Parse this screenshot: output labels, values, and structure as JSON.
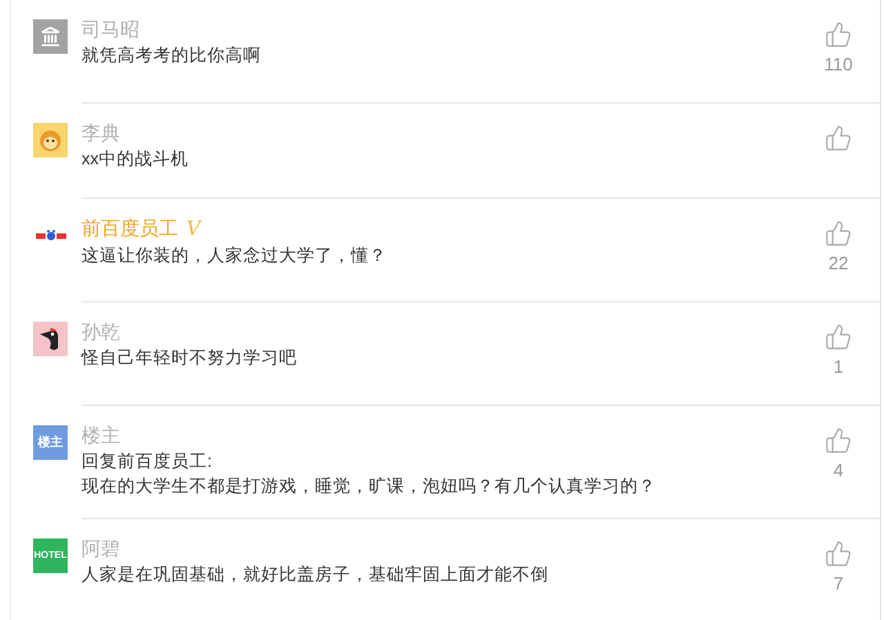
{
  "comments": [
    {
      "avatar": {
        "kind": "building",
        "color": "#a3a3a3"
      },
      "name": "司马昭",
      "vip": false,
      "lines": [
        "就凭高考考的比你高啊"
      ],
      "likes": "110"
    },
    {
      "avatar": {
        "kind": "face",
        "color": "#f7d56b"
      },
      "name": "李典",
      "vip": false,
      "lines": [
        "xx中的战斗机"
      ]
    },
    {
      "avatar": {
        "kind": "paw",
        "color": "#ffffff"
      },
      "name": "前百度员工",
      "vip": true,
      "vip_mark": "V",
      "lines": [
        "这逼让你装的，人家念过大学了，懂？"
      ],
      "likes": "22"
    },
    {
      "avatar": {
        "kind": "bird",
        "color": "#f3c3c8"
      },
      "name": "孙乾",
      "vip": false,
      "lines": [
        "怪自己年轻时不努力学习吧"
      ],
      "likes": "1"
    },
    {
      "avatar": {
        "kind": "label",
        "color": "#6f9be0",
        "label": "楼主"
      },
      "name": "楼主",
      "vip": false,
      "lines": [
        "回复前百度员工:",
        "现在的大学生不都是打游戏，睡觉，旷课，泡妞吗？有几个认真学习的？"
      ],
      "likes": "4"
    },
    {
      "avatar": {
        "kind": "label",
        "color": "#2eb55e",
        "label": "HOTEL"
      },
      "name": "阿碧",
      "vip": false,
      "lines": [
        "人家是在巩固基础，就好比盖房子，基础牢固上面才能不倒"
      ],
      "likes": "7"
    }
  ]
}
